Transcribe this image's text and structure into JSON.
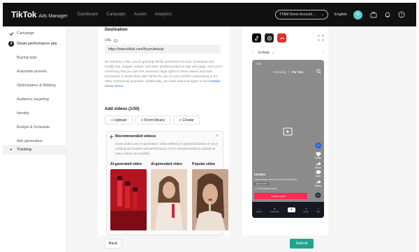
{
  "header": {
    "brand": "TikTok",
    "brand_sub": "Ads Manager",
    "nav": [
      "Dashboard",
      "Campaign",
      "Assets",
      "Analytics"
    ],
    "account": "TTAM Demo Account ...",
    "language": "English",
    "avatar_initial": "G"
  },
  "sidebar": {
    "items": [
      {
        "label": "Campaign",
        "state": "done"
      },
      {
        "label": "Smart performance ads",
        "state": "current",
        "step": "3"
      },
      {
        "label": "Buying type"
      },
      {
        "label": "Automate presets"
      },
      {
        "label": "Optimization & Bidding"
      },
      {
        "label": "Audience targeting"
      },
      {
        "label": "Identity"
      },
      {
        "label": "Budget & Schedule"
      },
      {
        "label": "Ads generation"
      },
      {
        "label": "Tracking",
        "state": "active"
      }
    ]
  },
  "destination": {
    "heading": "Destination",
    "url_label": "URL",
    "url_value": "https://www.tiktok.com/foryoubeauty",
    "consent_text": "By entering a URL, you're granting TikTok permission to scan, download, and modify text, images, videos, and other assets located on that web page, and you're confirming that you own the necessary legal rights to these assets and have permission to share them with TikTok for use on your behalf in advertising or for other commercial purposes. Additionally, you have read and agree to the",
    "consent_link": "Creative Genie Terms."
  },
  "add_videos": {
    "heading": "Add videos (1/30)",
    "buttons": [
      "+ Upload",
      "+ From library",
      "+ Create"
    ]
  },
  "recommended": {
    "title": "Recommended videos",
    "description": "Some videos are AI-generated. Video delivery is optimized based on your existing ad creative and performance, so it's recommended to upload as many videos as possible.",
    "columns": [
      "AI-generated video",
      "AI-generated video",
      "Popular video"
    ]
  },
  "footer": {
    "back": "Back",
    "submit": "Submit"
  },
  "preview": {
    "placement": "In-feed",
    "status_time": "9:41",
    "tab_following": "Following",
    "tab_foryou": "For You",
    "username": "tubsbts",
    "caption": "Lorem ipsum dolor sit amet consectetur",
    "sponsored": "Sponsored",
    "music": "Promotional music",
    "cta": "Learn more",
    "side_counts": [
      "Music",
      "Share",
      "Chat",
      "Share"
    ],
    "nav": [
      "Home",
      "Following",
      "",
      "Inbox",
      "Me"
    ]
  },
  "colors": {
    "accent": "#1fa58f",
    "cta": "#fe2c55",
    "link": "#2c66d9",
    "topbar": "#111111"
  }
}
